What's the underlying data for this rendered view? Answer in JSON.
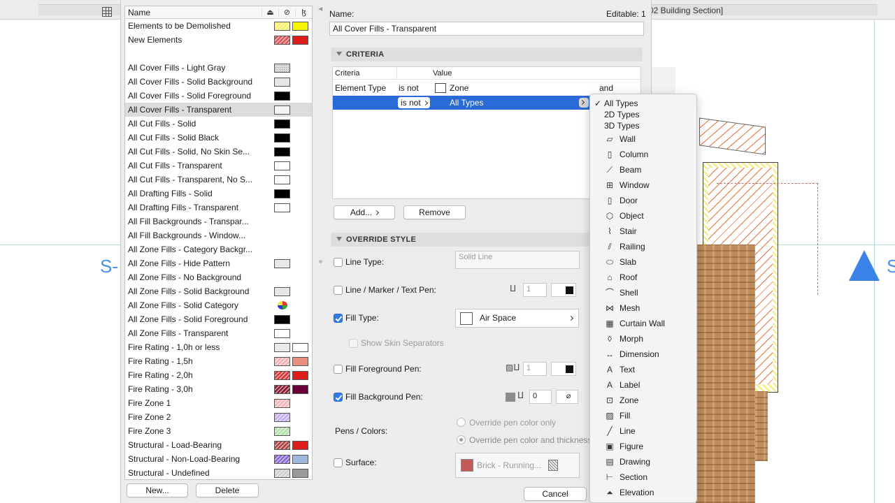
{
  "window": {
    "tab_fragment": "02 Building Section]"
  },
  "canvas": {
    "marker_left": "S-",
    "marker_right": "S"
  },
  "list": {
    "header": "Name",
    "items": [
      {
        "label": "Elements to be Demolished",
        "sw1": "#f7f26a",
        "sw1_style": "hatch",
        "sw2": "#f5f500"
      },
      {
        "label": "New Elements",
        "sw1": "#e35a5a",
        "sw1_style": "hatch",
        "sw2": "#e01b1b"
      },
      {
        "label": "",
        "gap": true
      },
      {
        "label": "All Cover Fills - Light Gray",
        "sw1": "#dcdcdc",
        "sw1_style": "dotted"
      },
      {
        "label": "All Cover Fills - Solid Background",
        "sw1": "#e6e6e6",
        "sw1_style": "plain"
      },
      {
        "label": "All Cover Fills - Solid Foreground",
        "sw1": "#000000",
        "sw1_style": "plain"
      },
      {
        "label": "All Cover Fills - Transparent",
        "sw1": "#f4f4f4",
        "sw1_style": "plain",
        "selected": true
      },
      {
        "label": "All Cut Fills - Solid",
        "sw1": "#000000",
        "sw1_style": "plain"
      },
      {
        "label": "All Cut Fills - Solid Black",
        "sw1": "#000000",
        "sw1_style": "plain"
      },
      {
        "label": "All Cut Fills - Solid, No Skin Se...",
        "sw1": "#000000",
        "sw1_style": "plain"
      },
      {
        "label": "All Cut Fills - Transparent",
        "sw1": "#ffffff",
        "sw1_style": "plain"
      },
      {
        "label": "All Cut Fills - Transparent, No S...",
        "sw1": "#ffffff",
        "sw1_style": "plain"
      },
      {
        "label": "All Drafting Fills - Solid",
        "sw1": "#000000",
        "sw1_style": "plain"
      },
      {
        "label": "All Drafting Fills - Transparent",
        "sw1": "#ffffff",
        "sw1_style": "plain"
      },
      {
        "label": "All Fill Backgrounds - Transpar..."
      },
      {
        "label": "All Fill Backgrounds - Window..."
      },
      {
        "label": "All Zone Fills - Category Backgr..."
      },
      {
        "label": "All Zone Fills - Hide Pattern",
        "sw1": "#e8e8e8",
        "sw1_style": "plain"
      },
      {
        "label": "All Zone Fills - No Background"
      },
      {
        "label": "All Zone Fills - Solid Background",
        "sw1": "#e6e6e6",
        "sw1_style": "plain"
      },
      {
        "label": "All Zone Fills - Solid Category",
        "palette": true
      },
      {
        "label": "All Zone Fills - Solid Foreground",
        "sw1": "#000000",
        "sw1_style": "plain"
      },
      {
        "label": "All Zone Fills - Transparent",
        "sw1": "#ffffff",
        "sw1_style": "plain"
      },
      {
        "label": "Fire Rating - 1,0h or less",
        "sw1": "#eaeaea",
        "sw1_style": "plain",
        "sw2": "#ffffff"
      },
      {
        "label": "Fire Rating - 1,5h",
        "sw1": "#f2b4b4",
        "sw1_style": "hatch",
        "sw2": "#e88f7f"
      },
      {
        "label": "Fire Rating - 2,0h",
        "sw1": "#d83c3c",
        "sw1_style": "hatch",
        "sw2": "#e01b1b"
      },
      {
        "label": "Fire Rating - 3,0h",
        "sw1": "#8c1f36",
        "sw1_style": "hatch",
        "sw2": "#6b0038"
      },
      {
        "label": "Fire Zone 1",
        "sw1": "#f5b8b8",
        "sw1_style": "hatch"
      },
      {
        "label": "Fire Zone 2",
        "sw1": "#c4b0f0",
        "sw1_style": "hatch"
      },
      {
        "label": "Fire Zone 3",
        "sw1": "#b4e0b0",
        "sw1_style": "hatch"
      },
      {
        "label": "Structural - Load-Bearing",
        "sw1": "#b04848",
        "sw1_style": "hatch",
        "sw2": "#e01b1b"
      },
      {
        "label": "Structural - Non-Load-Bearing",
        "sw1": "#8f6ad8",
        "sw1_style": "hatch",
        "sw2": "#9fb8e0"
      },
      {
        "label": "Structural - Undefined",
        "sw1": "#cfcfcf",
        "sw1_style": "hatch",
        "sw2": "#9a9a9a"
      }
    ],
    "new_button": "New...",
    "delete_button": "Delete"
  },
  "detail": {
    "name_label": "Name:",
    "editable": "Editable: 1",
    "name_value": "All Cover Fills - Transparent",
    "criteria_header": "CRITERIA",
    "col_criteria": "Criteria",
    "col_value": "Value",
    "row1": {
      "criteria": "Element Type",
      "operator": "is not",
      "value": "Zone",
      "conj": "and"
    },
    "row2": {
      "operator": "is not",
      "value": "All Types"
    },
    "add_button": "Add...",
    "remove_button": "Remove",
    "override_header": "OVERRIDE STYLE",
    "line_type_label": "Line Type:",
    "line_type_value": "Solid Line",
    "line_pen_label": "Line / Marker / Text Pen:",
    "line_pen_value": "1",
    "fill_type_label": "Fill Type:",
    "fill_type_checked": true,
    "fill_type_value": "Air Space",
    "skin_sep_label": "Show Skin Separators",
    "fill_fg_label": "Fill Foreground Pen:",
    "fill_fg_value": "1",
    "fill_bg_label": "Fill Background Pen:",
    "fill_bg_checked": true,
    "fill_bg_value": "0",
    "pens_colors_label": "Pens / Colors:",
    "radio_only_color": "Override pen color only",
    "radio_color_thickness": "Override pen color and thickness",
    "surface_label": "Surface:",
    "surface_value": "Brick - Running...",
    "cancel_button": "Cancel"
  },
  "menu": {
    "selected": "All Types",
    "items": [
      {
        "label": "All Types",
        "checked": true,
        "plain": true
      },
      {
        "label": "2D Types",
        "plain": true
      },
      {
        "label": "3D Types",
        "plain": true
      },
      {
        "label": "Wall",
        "icon": "wall-icon",
        "glyph": "▱"
      },
      {
        "label": "Column",
        "icon": "column-icon",
        "glyph": "▯"
      },
      {
        "label": "Beam",
        "icon": "beam-icon",
        "glyph": "⟋"
      },
      {
        "label": "Window",
        "icon": "window-icon",
        "glyph": "⊞"
      },
      {
        "label": "Door",
        "icon": "door-icon",
        "glyph": "▯"
      },
      {
        "label": "Object",
        "icon": "object-icon",
        "glyph": "⬡"
      },
      {
        "label": "Stair",
        "icon": "stair-icon",
        "glyph": "⌇"
      },
      {
        "label": "Railing",
        "icon": "railing-icon",
        "glyph": "⫽"
      },
      {
        "label": "Slab",
        "icon": "slab-icon",
        "glyph": "⬭"
      },
      {
        "label": "Roof",
        "icon": "roof-icon",
        "glyph": "⌂"
      },
      {
        "label": "Shell",
        "icon": "shell-icon",
        "glyph": "⌒"
      },
      {
        "label": "Mesh",
        "icon": "mesh-icon",
        "glyph": "⋈"
      },
      {
        "label": "Curtain Wall",
        "icon": "curtain-wall-icon",
        "glyph": "▦"
      },
      {
        "label": "Morph",
        "icon": "morph-icon",
        "glyph": "◊"
      },
      {
        "label": "Dimension",
        "icon": "dimension-icon",
        "glyph": "↔"
      },
      {
        "label": "Text",
        "icon": "text-icon",
        "glyph": "A"
      },
      {
        "label": "Label",
        "icon": "label-icon",
        "glyph": "A"
      },
      {
        "label": "Zone",
        "icon": "zone-icon",
        "glyph": "⊡"
      },
      {
        "label": "Fill",
        "icon": "fill-icon",
        "glyph": "▨"
      },
      {
        "label": "Line",
        "icon": "line-icon",
        "glyph": "╱"
      },
      {
        "label": "Figure",
        "icon": "figure-icon",
        "glyph": "▣"
      },
      {
        "label": "Drawing",
        "icon": "drawing-icon",
        "glyph": "▤"
      },
      {
        "label": "Section",
        "icon": "section-icon",
        "glyph": "⊢"
      },
      {
        "label": "Elevation",
        "icon": "elevation-icon",
        "glyph": "⏶"
      }
    ]
  },
  "colors": {
    "selection": "#2a6ad7",
    "accent_check": "#2f7ae5",
    "marker_blue": "#4a8fe8"
  }
}
